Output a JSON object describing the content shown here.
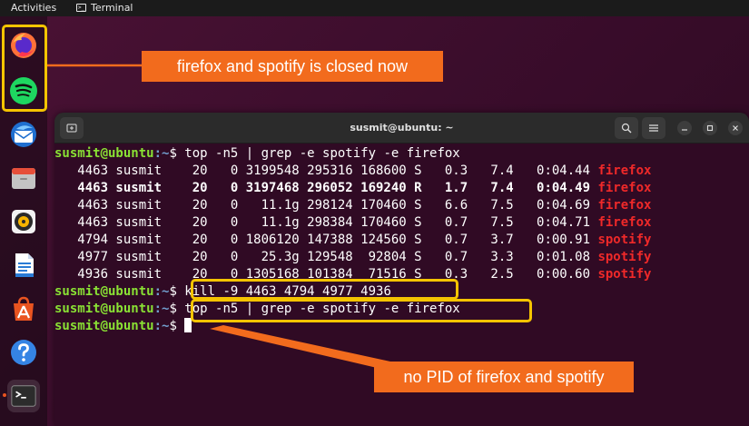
{
  "topbar": {
    "activities": "Activities",
    "app_name": "Terminal"
  },
  "terminal": {
    "title": "susmit@ubuntu: ~",
    "prompt_user": "susmit@ubuntu",
    "prompt_path": ":~",
    "prompt_symbol": "$ ",
    "commands": {
      "first": "top -n5 | grep -e spotify -e firefox",
      "kill": "kill -9 4463 4794 4977 4936",
      "second": "top -n5 | grep -e spotify -e firefox"
    },
    "processes": [
      {
        "text": "   4463 susmit    20   0 3199548 295316 168600 S   0.3   7.4   0:04.44 ",
        "name": "firefox",
        "bold": false
      },
      {
        "text": "   4463 susmit    20   0 3197468 296052 169240 R   1.7   7.4   0:04.49 ",
        "name": "firefox",
        "bold": true
      },
      {
        "text": "   4463 susmit    20   0   11.1g 298124 170460 S   6.6   7.5   0:04.69 ",
        "name": "firefox",
        "bold": false
      },
      {
        "text": "   4463 susmit    20   0   11.1g 298384 170460 S   0.7   7.5   0:04.71 ",
        "name": "firefox",
        "bold": false
      },
      {
        "text": "   4794 susmit    20   0 1806120 147388 124560 S   0.7   3.7   0:00.91 ",
        "name": "spotify",
        "bold": false
      },
      {
        "text": "   4977 susmit    20   0   25.3g 129548  92804 S   0.7   3.3   0:01.08 ",
        "name": "spotify",
        "bold": false
      },
      {
        "text": "   4936 susmit    20   0 1305168 101384  71516 S   0.3   2.5   0:00.60 ",
        "name": "spotify",
        "bold": false
      }
    ]
  },
  "callouts": {
    "top": "firefox and spotify is closed now",
    "bottom": "no PID of firefox and spotify"
  },
  "colors": {
    "callout_bg": "#f26b1d",
    "highlight": "#f5c400",
    "prompt_user": "#8ae234",
    "prompt_path": "#729fcf",
    "process_name": "#ef2929"
  },
  "dock": {
    "icons": [
      "firefox-icon",
      "spotify-icon",
      "thunderbird-icon",
      "files-icon",
      "rhythmbox-icon",
      "writer-icon",
      "app-center-icon",
      "help-icon",
      "terminal-icon"
    ]
  }
}
